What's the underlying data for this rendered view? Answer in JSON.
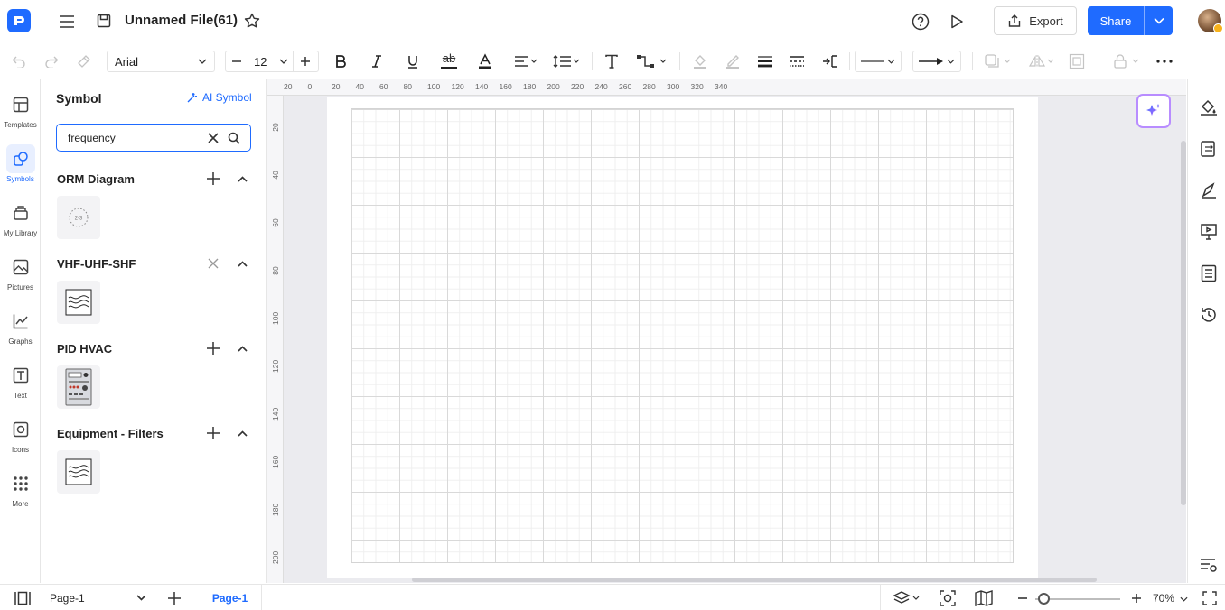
{
  "header": {
    "file_title": "Unnamed File(61)",
    "export_label": "Export",
    "share_label": "Share"
  },
  "toolbar": {
    "font_family": "Arial",
    "font_size": "12",
    "text_style_glyph": "ab"
  },
  "rail": {
    "items": [
      {
        "label": "Templates",
        "icon": "templates-icon"
      },
      {
        "label": "Symbols",
        "icon": "symbols-icon"
      },
      {
        "label": "My Library",
        "icon": "library-icon"
      },
      {
        "label": "Pictures",
        "icon": "pictures-icon"
      },
      {
        "label": "Graphs",
        "icon": "graphs-icon"
      },
      {
        "label": "Text",
        "icon": "text-icon"
      },
      {
        "label": "Icons",
        "icon": "icons-icon"
      },
      {
        "label": "More",
        "icon": "more-icon"
      }
    ],
    "active": "Symbols"
  },
  "panel": {
    "title": "Symbol",
    "ai_symbol_label": "AI Symbol",
    "search": {
      "value": "frequency",
      "placeholder": ""
    },
    "libraries": [
      {
        "title": "ORM Diagram",
        "action": "add",
        "symbol": "orm-symbol-icon",
        "symbol_text": "2-3"
      },
      {
        "title": "VHF-UHF-SHF",
        "action": "remove",
        "symbol": "waves-symbol-icon"
      },
      {
        "title": "PID HVAC",
        "action": "add",
        "symbol": "hvac-panel-symbol-icon"
      },
      {
        "title": "Equipment - Filters",
        "action": "add",
        "symbol": "filter-waves-symbol-icon"
      }
    ]
  },
  "ruler": {
    "top": [
      "20",
      "0",
      "20",
      "40",
      "60",
      "80",
      "100",
      "120",
      "140",
      "160",
      "180",
      "200",
      "220",
      "240",
      "260",
      "280",
      "300",
      "320",
      "340"
    ],
    "left": [
      "20",
      "40",
      "60",
      "80",
      "100",
      "120",
      "140",
      "160",
      "180",
      "200"
    ]
  },
  "status": {
    "page_select": "Page-1",
    "page_tab": "Page-1",
    "zoom": "70%",
    "zoom_level": 0.1
  },
  "colors": {
    "accent": "#1f6bff",
    "ai_border": "#b88cff"
  }
}
